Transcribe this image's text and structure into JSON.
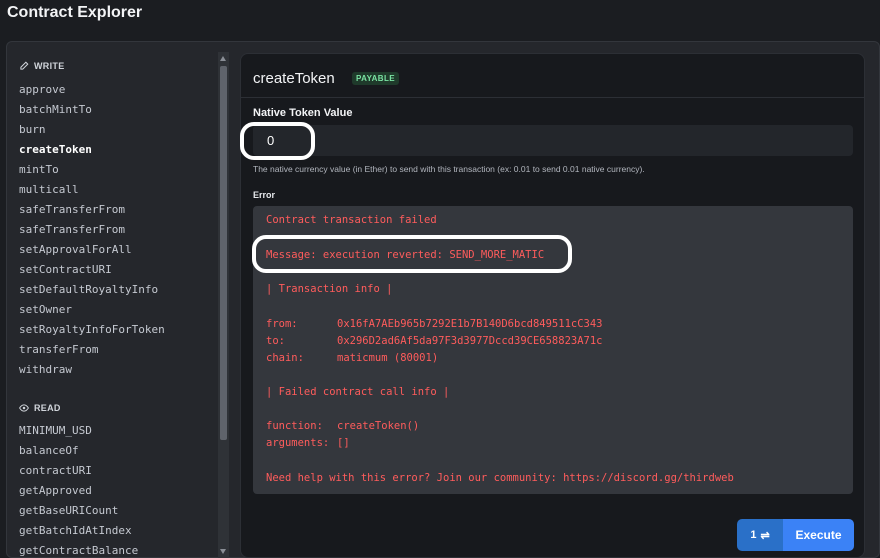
{
  "app": {
    "title": "Contract Explorer"
  },
  "sidebar": {
    "write_heading": "WRITE",
    "write_items": [
      "approve",
      "batchMintTo",
      "burn",
      "createToken",
      "mintTo",
      "multicall",
      "safeTransferFrom",
      "safeTransferFrom",
      "setApprovalForAll",
      "setContractURI",
      "setDefaultRoyaltyInfo",
      "setOwner",
      "setRoyaltyInfoForToken",
      "transferFrom",
      "withdraw"
    ],
    "active_item": "createToken",
    "read_heading": "READ",
    "read_items": [
      "MINIMUM_USD",
      "balanceOf",
      "contractURI",
      "getApproved",
      "getBaseURICount",
      "getBatchIdAtIndex",
      "getContractBalance"
    ]
  },
  "main": {
    "function_name": "createToken",
    "badge": "PAYABLE",
    "native_label": "Native Token Value",
    "native_value": "0",
    "native_help": "The native currency value (in Ether) to send with this transaction (ex: 0.01 to send 0.01 native currency).",
    "error_label": "Error",
    "error": {
      "title": "Contract transaction failed",
      "message": "Message: execution reverted: SEND_MORE_MATIC",
      "tx_info_header": "| Transaction info |",
      "from_key": "from:",
      "from_value": "0x16fA7AEb965b7292E1b7B140D6bcd849511cC343",
      "to_key": "to:",
      "to_value": "0x296D2ad6Af5da97F3d3977Dccd39CE658823A71c",
      "chain_key": "chain:",
      "chain_value": "maticmum (80001)",
      "call_info_header": "| Failed contract call info |",
      "function_key": "function:",
      "function_value": "createToken()",
      "arguments_key": "arguments:",
      "arguments_value": "[]",
      "help": "Need help with this error? Join our community: https://discord.gg/thirdweb"
    },
    "execute": {
      "count": "1",
      "count_icon": "⇌",
      "label": "Execute"
    }
  },
  "colors": {
    "accent": "#3b82f6",
    "error_text": "#ff5c5c",
    "badge_text": "#7be3a3"
  }
}
